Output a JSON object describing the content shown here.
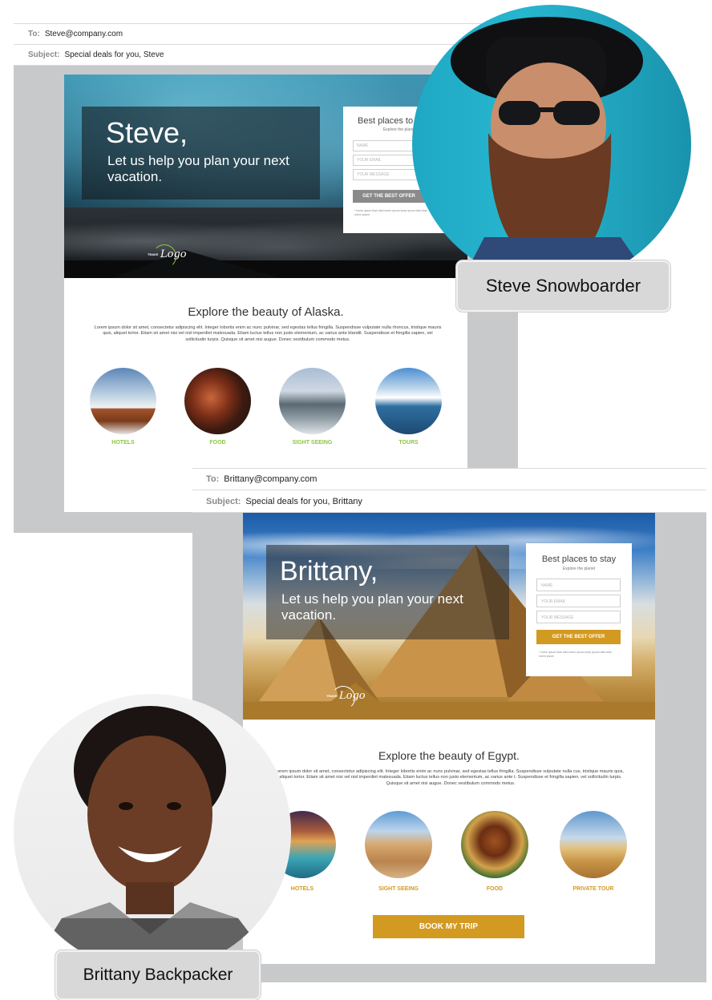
{
  "colors": {
    "alaska_accent": "#8cc63f",
    "alaska_button": "#8a8a8a",
    "egypt_accent": "#d39a22",
    "window_gray": "#c8c9cb"
  },
  "email_steve": {
    "to_label": "To:",
    "to_value": "Steve@company.com",
    "subject_label": "Subject:",
    "subject_value": "Special deals for you, Steve",
    "hero": {
      "name": "Steve,",
      "subtitle": "Let us help you plan your next vacation."
    },
    "form": {
      "title": "Best places to s",
      "subtitle": "Explore the planet",
      "field_name": "NAME",
      "field_email": "YOUR EMAIL",
      "field_message": "YOUR MESSAGE",
      "button": "GET THE BEST OFFER",
      "fine_print": "* lorem ipsum blah blah lorem ipsum lorep ipsum blah blah lorem ipsum"
    },
    "logo": {
      "small": "TRAVE",
      "word": "Logo"
    },
    "explore_title": "Explore the beauty of Alaska.",
    "body": "Lorem ipsum dolor sit amet, consectetur adipiscing elit. Integer lobortis enim ac nunc pulvinar, sed egestas tellus fringilla. Suspendisse vulputate nulla rhoncus, tristique mauris quis, aliquet tortor. Etiam sit amet nisi vel nisl imperdiet malesuada. Etiam luctus tellus non justo elementum, ac varius ante blandit. Suspendisse et fringilla sapien, vel sollicitudin turpis. Quisque sit amet nisi augue. Donec vestibulum commodo metus.",
    "categories": [
      {
        "label": "HOTELS",
        "icon": "hotel-image"
      },
      {
        "label": "FOOD",
        "icon": "food-image"
      },
      {
        "label": "SIGHT SEEING",
        "icon": "sightseeing-image"
      },
      {
        "label": "TOURS",
        "icon": "kayak-tour-image"
      }
    ]
  },
  "email_brittany": {
    "to_label": "To:",
    "to_value": "Brittany@company.com",
    "subject_label": "Subject:",
    "subject_value": "Special deals for you, Brittany",
    "hero": {
      "name": "Brittany,",
      "subtitle": "Let us help you plan your next vacation."
    },
    "form": {
      "title": "Best places to stay",
      "subtitle": "Explore the planet",
      "field_name": "NAME",
      "field_email": "YOUR EMAIL",
      "field_message": "YOUR MESSAGE",
      "button": "GET THE BEST OFFER",
      "fine_print": "* lorem ipsum blah blah lorem ipsum lorep ipsum blah blah lorem ipsum"
    },
    "logo": {
      "small": "TRAVE",
      "word": "Logo"
    },
    "explore_title": "Explore the beauty of Egypt.",
    "body": "orem ipsum dolor sit amet, consectetur adipiscing elit. Integer lobortis enim ac nunc pulvinar, sed egestas tellus fringilla. Suspendisse vulputate nulla cus, tristique mauris quis, aliquet tortor. Etiam sit amet nisi vel nisl imperdiet malesuada. Etiam luctus tellus non justo elementum, ac varius ante t. Suspendisse et fringilla sapien, vel sollicitudin turpis. Quisque sit amet nisi augue. Donec vestibulum commodo metus.",
    "categories": [
      {
        "label": "HOTELS",
        "icon": "resort-image"
      },
      {
        "label": "SIGHT SEEING",
        "icon": "sphinx-image"
      },
      {
        "label": "FOOD",
        "icon": "food-image"
      },
      {
        "label": "PRIVATE TOUR",
        "icon": "camel-tour-image"
      }
    ],
    "book_button": "BOOK MY TRIP"
  },
  "personas": {
    "steve": "Steve Snowboarder",
    "brittany": "Brittany Backpacker"
  }
}
